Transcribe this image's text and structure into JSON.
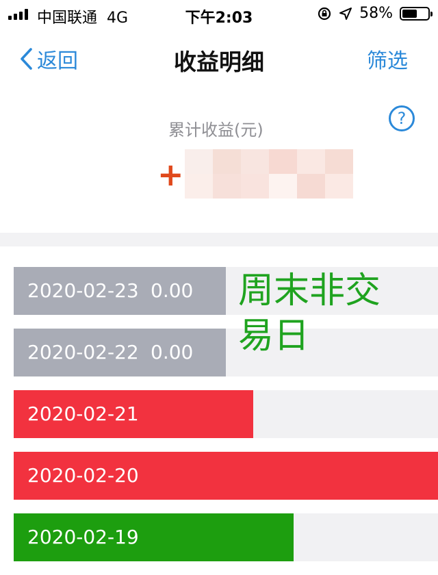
{
  "status_bar": {
    "carrier": "中国联通",
    "network": "4G",
    "time": "下午2:03",
    "battery": "58%",
    "battery_level": 0.58
  },
  "nav": {
    "back_label": "返回",
    "title": "收益明细",
    "filter_label": "筛选"
  },
  "summary": {
    "label": "累计收益(元)",
    "sign": "+",
    "help_icon": "?"
  },
  "rows": [
    {
      "date": "2020-02-23",
      "value": "0.00",
      "kind": "neutral",
      "fill": 0.5
    },
    {
      "date": "2020-02-22",
      "value": "0.00",
      "kind": "neutral",
      "fill": 0.5
    },
    {
      "date": "2020-02-21",
      "value": "",
      "kind": "gain",
      "fill": 0.565
    },
    {
      "date": "2020-02-20",
      "value": "",
      "kind": "gain",
      "fill": 1.0
    },
    {
      "date": "2020-02-19",
      "value": "",
      "kind": "loss",
      "fill": 0.66
    }
  ],
  "annotation": "周末非交易日",
  "colors": {
    "accent": "#2b89d9",
    "gain": "#f2323f",
    "loss": "#1d9e0f",
    "neutral": "#a9acb6",
    "annotation": "#1fa31f",
    "plus": "#e0491c"
  }
}
